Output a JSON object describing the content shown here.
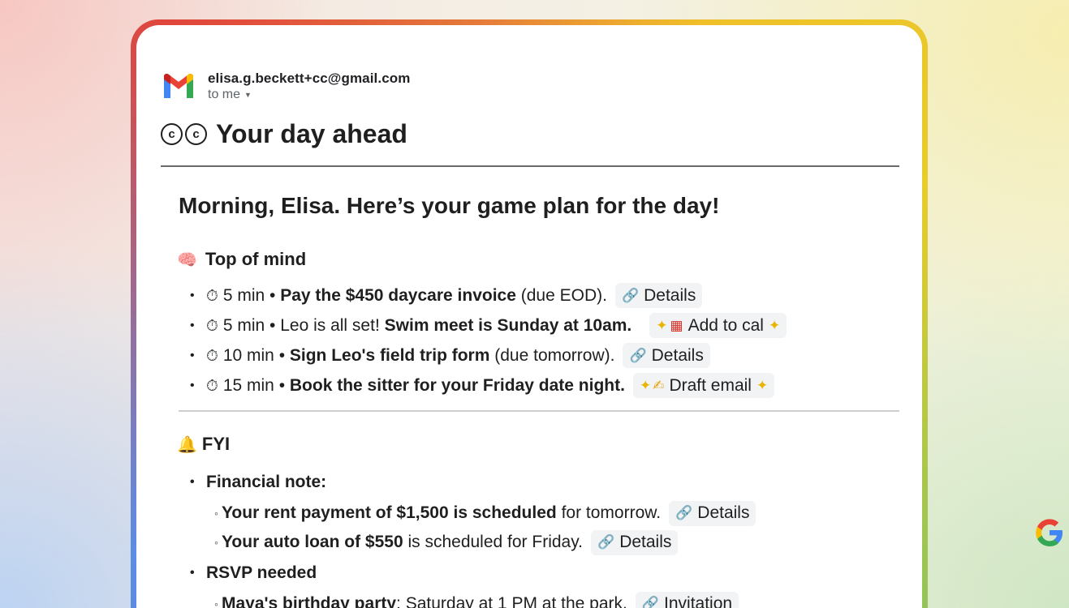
{
  "email": {
    "sender": "elisa.g.beckett+cc@gmail.com",
    "recipient_label": "to me",
    "subject_icons": [
      "©",
      "©"
    ],
    "subject": "Your day ahead",
    "greeting": "Morning, Elisa. Here’s your game plan for the day!"
  },
  "top_of_mind": {
    "icon": "brain-icon",
    "title": "Top of mind",
    "tasks": [
      {
        "time": "5 min •",
        "text_bold": "Pay the $450 daycare invoice",
        "text_rest": "(due EOD).",
        "text_pre": "",
        "action": "Details",
        "action_icon": "link-icon"
      },
      {
        "time": "5 min •",
        "text_pre": "Leo is all set!",
        "text_bold": "Swim meet is Sunday at 10am.",
        "text_rest": "",
        "action": "Add to cal",
        "action_icon": "calendar-icon"
      },
      {
        "time": "10 min •",
        "text_pre": "",
        "text_bold": "Sign Leo's field trip form",
        "text_rest": "(due tomorrow).",
        "action": "Details",
        "action_icon": "link-icon"
      },
      {
        "time": "15 min •",
        "text_pre": "",
        "text_bold": "Book the sitter for your Friday date night.",
        "text_rest": "",
        "action": "Draft email",
        "action_icon": "writing-hand-icon"
      }
    ]
  },
  "fyi": {
    "icon": "bell-icon",
    "title": "FYI",
    "financial_title": "Financial note:",
    "financial_items": [
      {
        "text_bold": "Your rent payment of $1,500 is scheduled",
        "text_rest": "for tomorrow.",
        "action": "Details"
      },
      {
        "text_bold": "Your auto loan of $550",
        "text_rest": "is scheduled for Friday.",
        "action": "Details"
      }
    ],
    "rsvp_title": "RSVP needed",
    "rsvp_items": [
      {
        "text_bold": "Maya's birthday party",
        "text_rest": ": Saturday at 1 PM at the park.",
        "action": "Invitation"
      }
    ]
  }
}
